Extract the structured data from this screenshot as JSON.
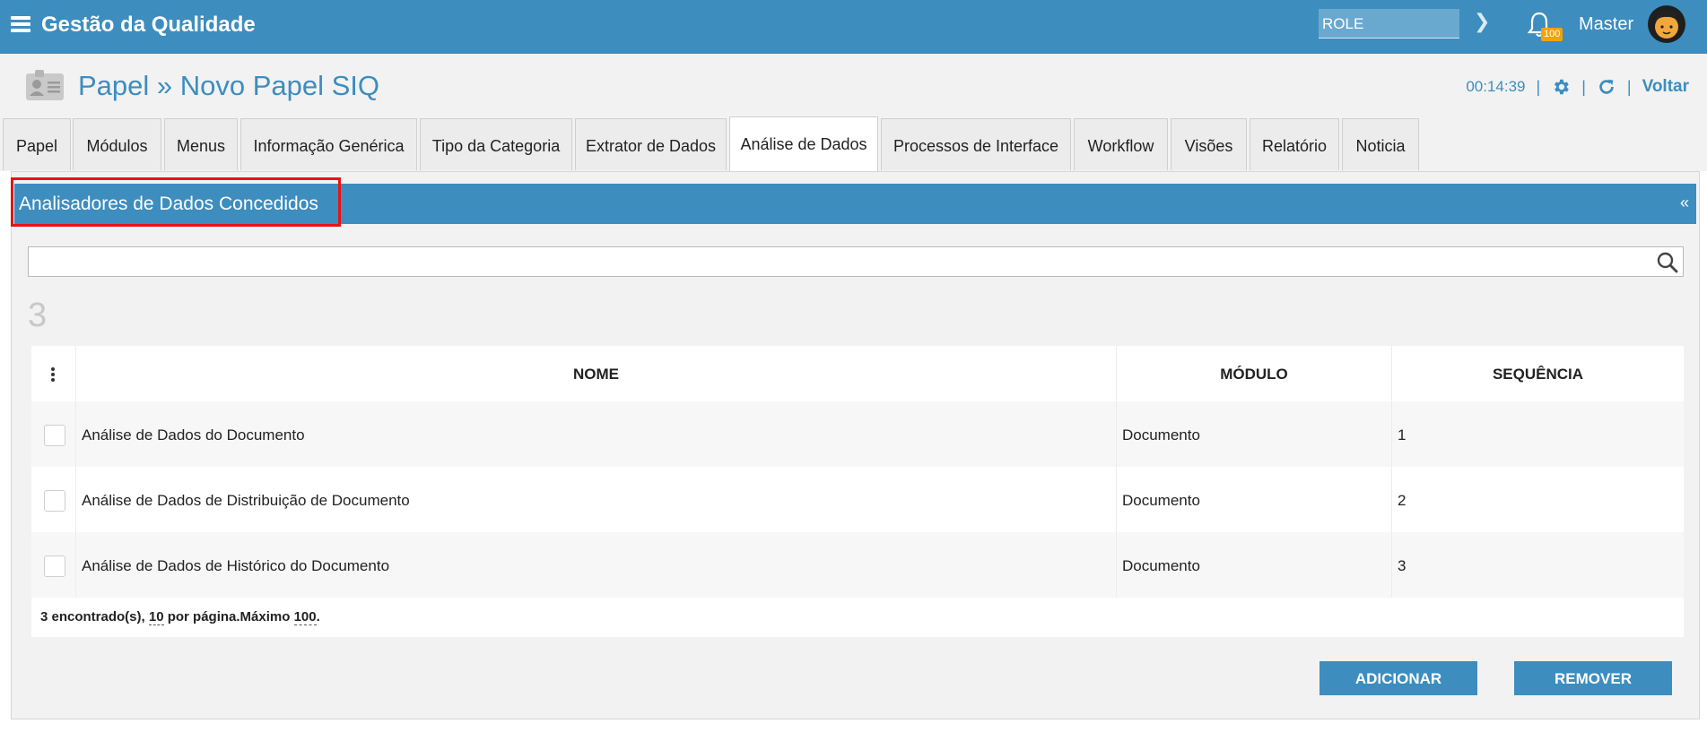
{
  "topbar": {
    "title": "Gestão da Qualidade",
    "role_value": "ROLE",
    "notification_count": "100",
    "user_name": "Master"
  },
  "header": {
    "breadcrumb": "Papel » Novo Papel SIQ",
    "timer": "00:14:39",
    "voltar_label": "Voltar"
  },
  "tabs": [
    {
      "label": "Papel"
    },
    {
      "label": "Módulos"
    },
    {
      "label": "Menus"
    },
    {
      "label": "Informação Genérica"
    },
    {
      "label": "Tipo da Categoria"
    },
    {
      "label": "Extrator de Dados"
    },
    {
      "label": "Análise de Dados"
    },
    {
      "label": "Processos de Interface"
    },
    {
      "label": "Workflow"
    },
    {
      "label": "Visões"
    },
    {
      "label": "Relatório"
    },
    {
      "label": "Noticia"
    }
  ],
  "active_tab": "Análise de Dados",
  "panel": {
    "title": "Analisadores de Dados Concedidos",
    "collapse_label": "«",
    "search_placeholder": "",
    "count": "3"
  },
  "table": {
    "columns": [
      "NOME",
      "MÓDULO",
      "SEQUÊNCIA"
    ],
    "rows": [
      {
        "nome": "Análise de Dados do Documento",
        "modulo": "Documento",
        "sequencia": "1"
      },
      {
        "nome": "Análise de Dados de Distribuição de Documento",
        "modulo": "Documento",
        "sequencia": "2"
      },
      {
        "nome": "Análise de Dados de Histórico do Documento",
        "modulo": "Documento",
        "sequencia": "3"
      }
    ],
    "footer": {
      "found_text": "3 encontrado(s),",
      "per_page_value": "10",
      "per_page_text": "por página.Máximo",
      "max_value": "100",
      "period": "."
    }
  },
  "buttons": {
    "adicionar": "ADICIONAR",
    "remover": "REMOVER"
  },
  "colors": {
    "primary": "#3d8dbf",
    "badge": "#f0a30a",
    "highlight": "#e81313"
  },
  "icons": [
    "menu-icon",
    "chevron-right-icon",
    "bell-icon",
    "avatar",
    "id-card-icon",
    "gear-icon",
    "refresh-icon",
    "search-icon",
    "kebab-icon"
  ]
}
